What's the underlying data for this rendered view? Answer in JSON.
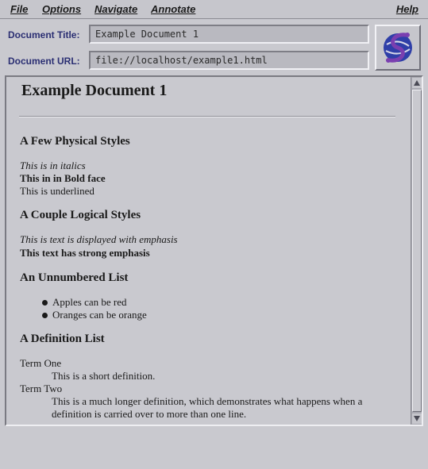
{
  "menu": {
    "file": "File",
    "options": "Options",
    "navigate": "Navigate",
    "annotate": "Annotate",
    "help": "Help"
  },
  "fields": {
    "title_label": "Document Title:",
    "title_value": "Example Document 1",
    "url_label": "Document URL:",
    "url_value": "file://localhost/example1.html"
  },
  "logo": {
    "icon": "mosaic-globe-icon",
    "colors": {
      "globe": "#2f3fa8",
      "swoosh": "#7a3fb0"
    }
  },
  "document": {
    "title": "Example Document 1",
    "sections": {
      "physical": {
        "heading": "A Few Physical Styles",
        "italic": "This is in italics",
        "bold": "This in in Bold face",
        "underline": "This is underlined"
      },
      "logical": {
        "heading": "A Couple Logical Styles",
        "emphasis": "This is text is displayed with emphasis",
        "strong": "This text has strong emphasis"
      },
      "unnumbered": {
        "heading": "An Unnumbered List",
        "items": [
          "Apples can be red",
          "Oranges can be orange"
        ]
      },
      "definition": {
        "heading": "A Definition List",
        "terms": [
          {
            "term": "Term One",
            "definition": "This is a short definition."
          },
          {
            "term": "Term Two",
            "definition": "This is a much longer definition, which demonstrates what happens when a definition is carried over to more than one line."
          }
        ]
      }
    }
  }
}
